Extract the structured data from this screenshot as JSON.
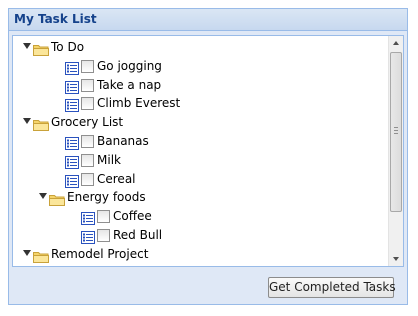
{
  "panel": {
    "title": "My Task List"
  },
  "tree": {
    "nodes": [
      {
        "label": "To Do",
        "kind": "folder",
        "depth": 0,
        "expanded": true
      },
      {
        "label": "Go jogging",
        "kind": "task",
        "depth": 1,
        "checked": false
      },
      {
        "label": "Take a nap",
        "kind": "task",
        "depth": 1,
        "checked": false
      },
      {
        "label": "Climb Everest",
        "kind": "task",
        "depth": 1,
        "checked": false
      },
      {
        "label": "Grocery List",
        "kind": "folder",
        "depth": 0,
        "expanded": true
      },
      {
        "label": "Bananas",
        "kind": "task",
        "depth": 1,
        "checked": false
      },
      {
        "label": "Milk",
        "kind": "task",
        "depth": 1,
        "checked": false
      },
      {
        "label": "Cereal",
        "kind": "task",
        "depth": 1,
        "checked": false
      },
      {
        "label": "Energy foods",
        "kind": "folder",
        "depth": 1,
        "expanded": true
      },
      {
        "label": "Coffee",
        "kind": "task",
        "depth": 2,
        "checked": false
      },
      {
        "label": "Red Bull",
        "kind": "task",
        "depth": 2,
        "checked": false
      },
      {
        "label": "Remodel Project",
        "kind": "folder",
        "depth": 0,
        "expanded": true
      }
    ]
  },
  "toolbar": {
    "get_completed_label": "Get Completed Tasks"
  },
  "icons": {
    "folder": "folder-icon",
    "task": "task-list-icon",
    "expander": "expand-triangle-icon",
    "checkbox": "checkbox-icon"
  },
  "colors": {
    "panel_bg": "#dfe8f6",
    "panel_border": "#99bbe8",
    "title_text": "#15428b",
    "folder": "#f5d46a",
    "task_icon": "#2a52be"
  }
}
